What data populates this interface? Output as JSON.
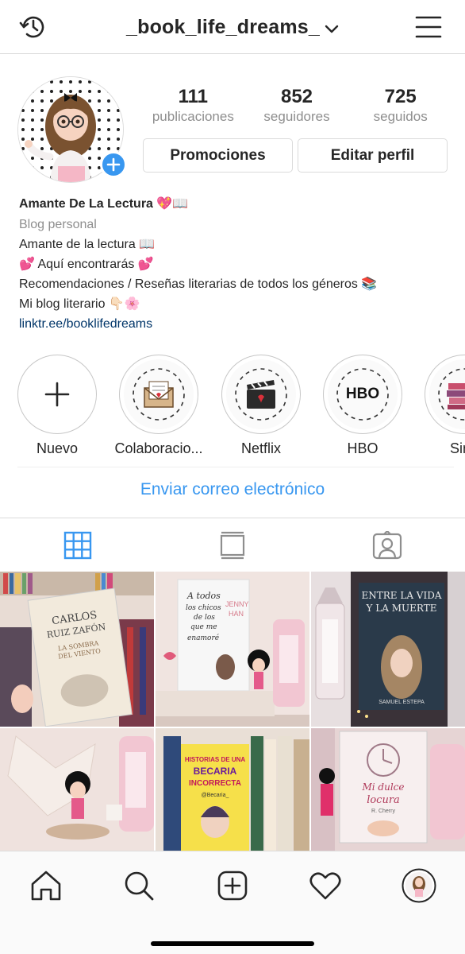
{
  "header": {
    "username": "_book_life_dreams_",
    "left_icon": "history-icon",
    "right_icon": "menu-icon"
  },
  "profile": {
    "stats": [
      {
        "value": "111",
        "label": "publicaciones"
      },
      {
        "value": "852",
        "label": "seguidores"
      },
      {
        "value": "725",
        "label": "seguidos"
      }
    ],
    "promo_button": "Promociones",
    "edit_button": "Editar perfil"
  },
  "bio": {
    "name": "Amante De La Lectura 💖📖",
    "category": "Blog personal",
    "line1": "Amante de la lectura 📖",
    "line2": "💕 Aquí encontrarás 💕",
    "line3": "Recomendaciones / Reseñas literarias de todos los géneros 📚",
    "line4": "Mi blog literario 👇🏻🌸",
    "link": "linktr.ee/booklifedreams"
  },
  "highlights": [
    {
      "label": "Nuevo"
    },
    {
      "label": "Colaboracio..."
    },
    {
      "label": "Netflix"
    },
    {
      "label": "HBO",
      "badge": "HBO"
    },
    {
      "label": "Sino"
    }
  ],
  "email_link": "Enviar correo electrónico",
  "tabs": [
    "grid-icon",
    "igtv-icon",
    "tagged-icon"
  ],
  "posts": [
    {
      "book_text": "CARLOS RUIZ ZAFÓN",
      "subtitle": "LA SOMBRA DEL VIENTO"
    },
    {
      "book_text": "A todos los chicos de los que me enamoré",
      "author": "JENNY HAN"
    },
    {
      "book_text": "ENTRE LA VIDA Y LA MUERTE",
      "author": "SAMUEL ESTEPA"
    },
    {
      "book_text": ""
    },
    {
      "book_text": "HISTORIAS DE UNA BECARIA INCORRECTA",
      "author": "@Becaria_"
    },
    {
      "book_text": "Mi dulce locura",
      "author": "R. Cherry"
    }
  ],
  "colors": {
    "accent": "#3897f0",
    "text": "#262626",
    "muted": "#8e8e8e",
    "link": "#003569",
    "border": "#dbdbdb"
  },
  "bottom_nav": [
    "home-icon",
    "search-icon",
    "add-post-icon",
    "heart-icon",
    "profile-avatar"
  ]
}
